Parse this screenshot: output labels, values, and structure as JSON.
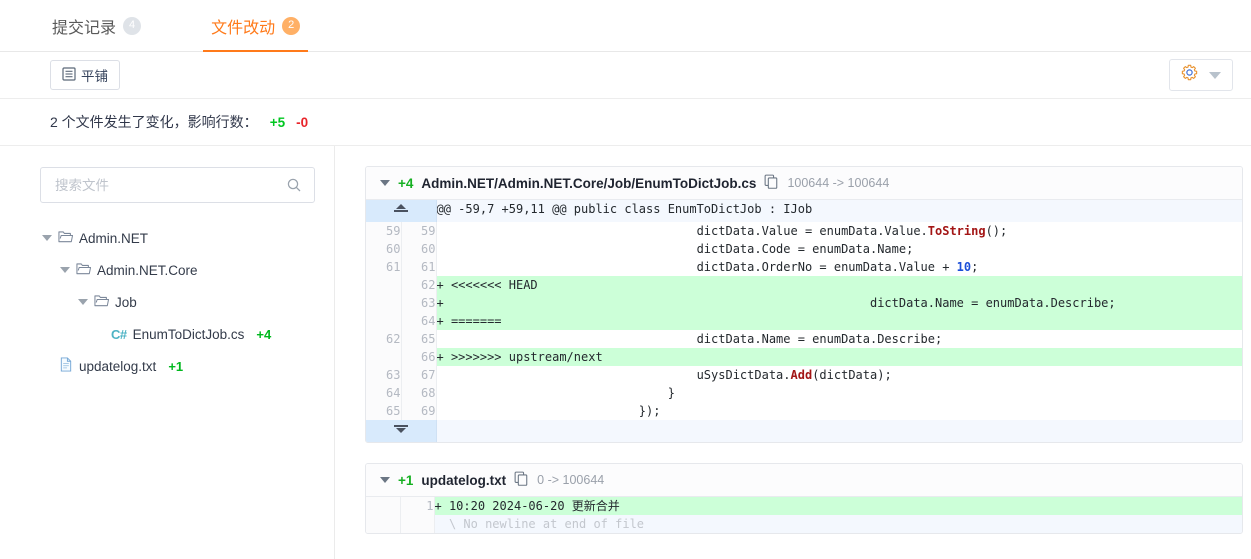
{
  "tabs": [
    {
      "label": "提交记录",
      "badge": "4",
      "active": false
    },
    {
      "label": "文件改动",
      "badge": "2",
      "active": true
    }
  ],
  "toolbar": {
    "layout_button_label": "平铺",
    "layout_icon": "list-view-icon",
    "settings_icon": "gear-icon",
    "settings_caret_icon": "chevron-down-icon"
  },
  "summary": {
    "text": "2 个文件发生了变化，影响行数：",
    "additions": "+5",
    "deletions": "-0",
    "addition_color": "#00c721",
    "deletion_color": "#e8242a"
  },
  "sidebar": {
    "search": {
      "placeholder": "搜索文件",
      "value": "",
      "icon": "search-icon"
    },
    "tree": [
      {
        "label": "Admin.NET",
        "type": "folder",
        "depth": 0,
        "expanded": true,
        "stat": ""
      },
      {
        "label": "Admin.NET.Core",
        "type": "folder",
        "depth": 1,
        "expanded": true,
        "stat": ""
      },
      {
        "label": "Job",
        "type": "folder",
        "depth": 2,
        "expanded": true,
        "stat": ""
      },
      {
        "label": "EnumToDictJob.cs",
        "type": "csharp",
        "depth": 3,
        "expanded": false,
        "stat": "+4",
        "icon_text": "C#"
      },
      {
        "label": "updatelog.txt",
        "type": "text",
        "depth": 0,
        "expanded": false,
        "stat": "+1"
      }
    ]
  },
  "diff_files": [
    {
      "additions": "+4",
      "path": "Admin.NET/Admin.NET.Core/Job/EnumToDictJob.cs",
      "copy_icon": "copy-icon",
      "mode": "100644 -> 100644",
      "expand_top": true,
      "expand_bottom": true,
      "hunk_header": "@@ -59,7 +59,11 @@ public class EnumToDictJob : IJob",
      "rows": [
        {
          "kind": "ctx",
          "old": "59",
          "new": "59",
          "code": "                                    dictData.Value = enumData.Value.[[ToString]]();"
        },
        {
          "kind": "ctx",
          "old": "60",
          "new": "60",
          "code": "                                    dictData.Code = enumData.Name;"
        },
        {
          "kind": "ctx",
          "old": "61",
          "new": "61",
          "code": "                                    dictData.OrderNo = enumData.Value + {{10}};"
        },
        {
          "kind": "add",
          "old": "",
          "new": "62",
          "code": "+ <<<<<<< HEAD"
        },
        {
          "kind": "add",
          "old": "",
          "new": "63",
          "code": "+                                                           dictData.Name = enumData.Describe;"
        },
        {
          "kind": "add",
          "old": "",
          "new": "64",
          "code": "+ ======="
        },
        {
          "kind": "ctx",
          "old": "62",
          "new": "65",
          "code": "                                    dictData.Name = enumData.Describe;"
        },
        {
          "kind": "add",
          "old": "",
          "new": "66",
          "code": "+ >>>>>>> upstream/next"
        },
        {
          "kind": "ctx",
          "old": "63",
          "new": "67",
          "code": "                                    uSysDictData.[[Add]](dictData);"
        },
        {
          "kind": "ctx",
          "old": "64",
          "new": "68",
          "code": "                                }"
        },
        {
          "kind": "ctx",
          "old": "65",
          "new": "69",
          "code": "                            });"
        }
      ]
    },
    {
      "additions": "+1",
      "path": "updatelog.txt",
      "copy_icon": "copy-icon",
      "mode": "0 -> 100644",
      "expand_top": false,
      "expand_bottom": false,
      "hunk_header": "",
      "rows": [
        {
          "kind": "add",
          "old": "",
          "new": "1",
          "code": "+ 10:20 2024-06-20 更新合并"
        },
        {
          "kind": "nonl",
          "old": "",
          "new": "",
          "code": "  \\ No newline at end of file"
        }
      ]
    }
  ],
  "colors": {
    "accent": "#ff7a1a",
    "diff_add_bg": "#ccffd8",
    "hunk_bg": "#f4f8fe",
    "gutter_expand_bg": "#d8eafc"
  }
}
